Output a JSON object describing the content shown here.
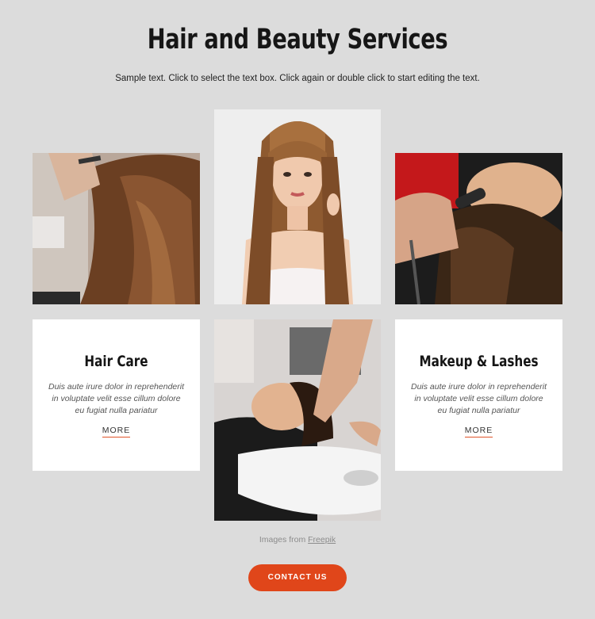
{
  "header": {
    "title": "Hair and Beauty Services",
    "subtitle": "Sample text. Click to select the text box. Click again or double click to start editing the text."
  },
  "cards": [
    {
      "title": "Hair Care",
      "text": "Duis aute irure dolor in reprehenderit in voluptate velit esse cillum dolore eu fugiat nulla pariatur",
      "more": "MORE"
    },
    {
      "title": "Makeup & Lashes",
      "text": "Duis aute irure dolor in reprehenderit in voluptate velit esse cillum dolore eu fugiat nulla pariatur",
      "more": "MORE"
    }
  ],
  "credit": {
    "prefix": "Images from",
    "link": "Freepik"
  },
  "cta": {
    "label": "CONTACT US"
  },
  "colors": {
    "background": "#dcdcdc",
    "accent": "#e0461a",
    "card": "#ffffff"
  }
}
